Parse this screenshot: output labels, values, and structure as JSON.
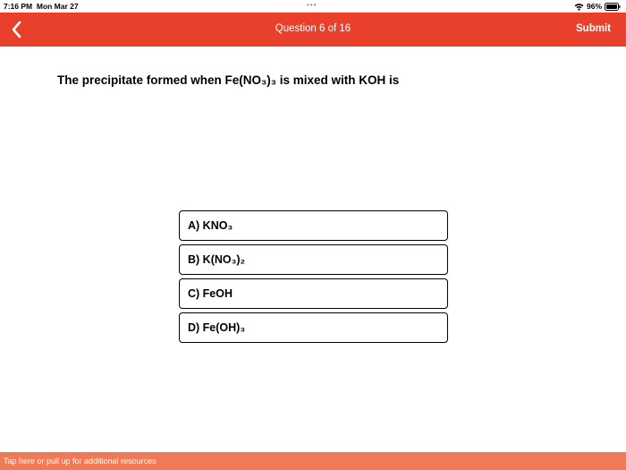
{
  "status_bar": {
    "time": "7:16 PM",
    "date": "Mon Mar 27",
    "dots": "•••",
    "battery_percent": "96%"
  },
  "header": {
    "back_icon": "chevron-left-icon",
    "title": "Question 6 of 16",
    "submit_label": "Submit"
  },
  "question": {
    "text": "The precipitate formed when Fe(NO₃)₃ is mixed with KOH is"
  },
  "options": [
    {
      "label": "A) KNO₃"
    },
    {
      "label": "B) K(NO₃)₂"
    },
    {
      "label": "C) FeOH"
    },
    {
      "label": "D) Fe(OH)₃"
    }
  ],
  "footer": {
    "resources_text": "Tap here or pull up for additional resources"
  },
  "colors": {
    "header_bg": "#e8402b",
    "footer_bg": "#f07a55",
    "text": "#000000",
    "header_text": "#ffffff"
  }
}
